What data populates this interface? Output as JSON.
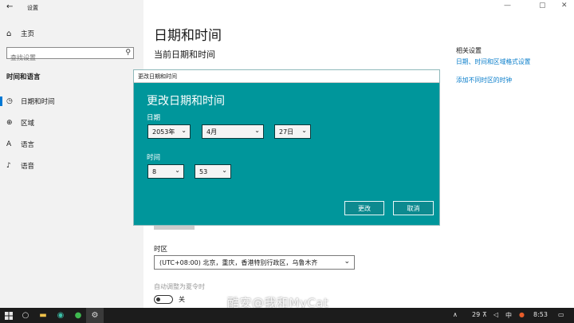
{
  "window": {
    "title": "设置",
    "minimize_glyph": "—",
    "maximize_glyph": "▢",
    "close_glyph": "✕"
  },
  "sidebar": {
    "home_label": "主页",
    "search_placeholder": "查找设置",
    "section_title": "时间和语言",
    "items": [
      {
        "label": "日期和时间",
        "icon": "clock-icon",
        "active": true
      },
      {
        "label": "区域",
        "icon": "globe-icon",
        "active": false
      },
      {
        "label": "语言",
        "icon": "language-icon",
        "active": false
      },
      {
        "label": "语音",
        "icon": "microphone-icon",
        "active": false
      }
    ]
  },
  "main": {
    "page_title": "日期和时间",
    "subtitle": "当前日期和时间",
    "related": {
      "heading": "相关设置",
      "links": [
        "日期、时间和区域格式设置",
        "添加不同时区的时钟"
      ]
    },
    "timezone_label": "时区",
    "timezone_value": "(UTC+08:00) 北京，重庆，香港特别行政区，乌鲁木齐",
    "dst_label": "自动调整为夏令时",
    "dst_toggle_state": "关"
  },
  "dialog": {
    "window_title": "更改日期和时间",
    "heading": "更改日期和时间",
    "date_label": "日期",
    "year": "2053年",
    "month": "4月",
    "day": "27日",
    "time_label": "时间",
    "hour": "8",
    "minute": "53",
    "change_button": "更改",
    "cancel_button": "取消"
  },
  "taskbar": {
    "tray_temp": "29",
    "ime": "中",
    "clock": "8:53"
  },
  "watermark": "酷安@我和MyCat",
  "colors": {
    "dialog_bg": "#00969b",
    "accent": "#0078d4",
    "link": "#0a7ecb",
    "taskbar": "#1c1c1c"
  }
}
